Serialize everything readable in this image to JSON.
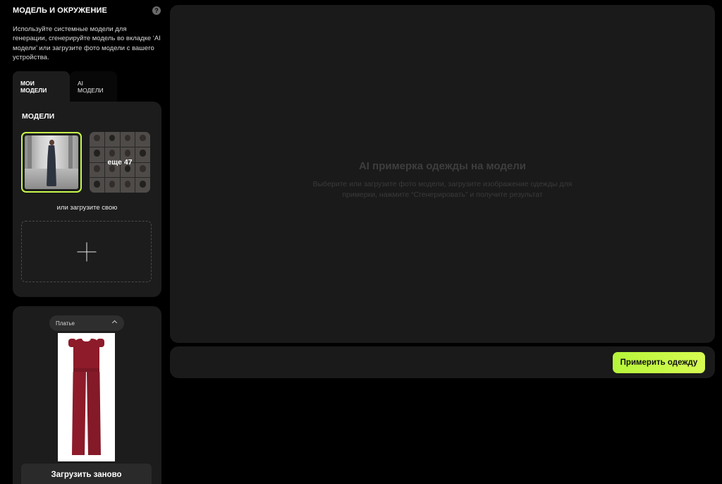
{
  "sidebar": {
    "title": "МОДЕЛЬ И ОКРУЖЕНИЕ",
    "help_icon": "?",
    "description": "Используйте системные модели для генерации, сгенерируйте модель во вкладке ‘AI модели’ или загрузите фото модели с вашего устройства.",
    "tabs": [
      {
        "label": "МОИ МОДЕЛИ",
        "active": true
      },
      {
        "label": "AI МОДЕЛИ",
        "active": false
      }
    ],
    "models": {
      "title": "МОДЕЛИ",
      "more_label": "еще 47",
      "upload_label": "или загрузите свою",
      "selected_border_color": "#c6f94a"
    },
    "garment": {
      "category": "Платье",
      "reupload_label": "Загрузить заново"
    }
  },
  "main": {
    "empty_title": "AI примерка одежды на модели",
    "empty_description": "Выберите или загрузите фото модели, загрузите изображение одежды для примерки, нажмите “Сгенерировать” и получите результат",
    "tryon_button": "Примерить одежду",
    "accent_color": "#c6f94a"
  }
}
